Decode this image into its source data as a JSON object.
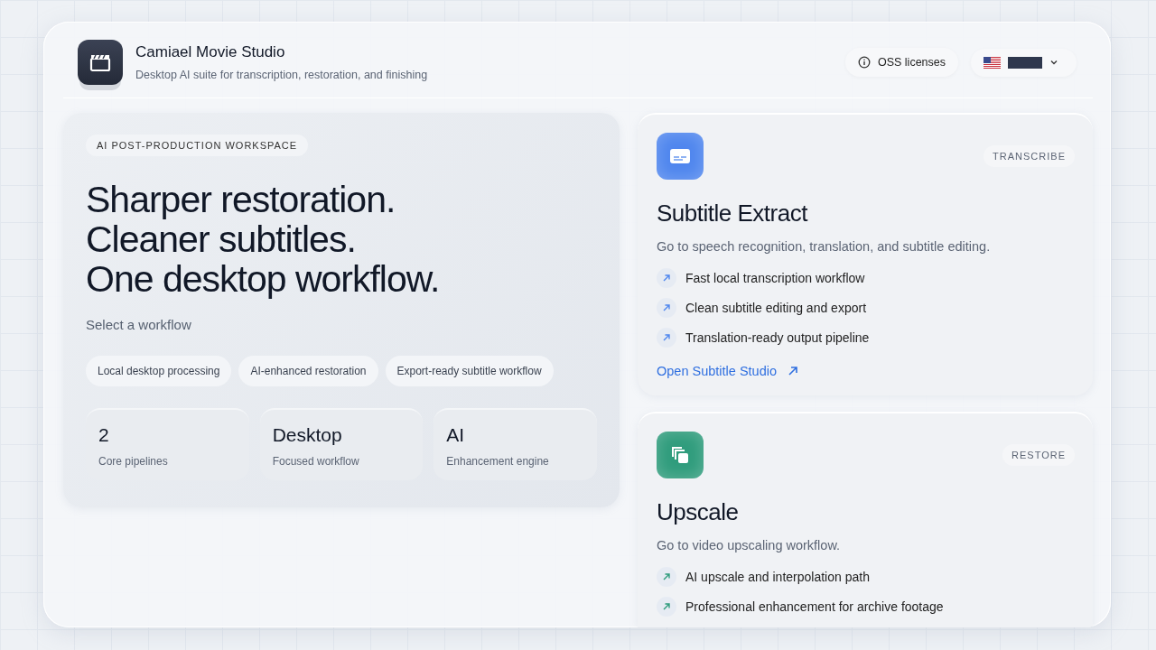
{
  "app": {
    "title": "Camiael Movie Studio",
    "subtitle": "Desktop AI suite for transcription, restoration, and finishing"
  },
  "header_actions": {
    "licenses": "OSS licenses"
  },
  "hero": {
    "eyebrow": "AI POST-PRODUCTION WORKSPACE",
    "headline": [
      "Sharper restoration.",
      "Cleaner subtitles.",
      "One desktop workflow."
    ],
    "prompt": "Select a workflow",
    "chips": [
      "Local desktop processing",
      "AI-enhanced restoration",
      "Export-ready subtitle workflow"
    ],
    "stats": [
      {
        "value": "2",
        "label": "Core pipelines"
      },
      {
        "value": "Desktop",
        "label": "Focused workflow"
      },
      {
        "value": "AI",
        "label": "Enhancement engine"
      }
    ]
  },
  "workflows": [
    {
      "kind": "subtitle",
      "color": "#4f86ee",
      "tag": "TRANSCRIBE",
      "title": "Subtitle Extract",
      "description": "Go to speech recognition, translation, and subtitle editing.",
      "features": [
        "Fast local transcription workflow",
        "Clean subtitle editing and export",
        "Translation-ready output pipeline"
      ],
      "link": "Open Subtitle Studio"
    },
    {
      "kind": "upscale",
      "color": "#2f9c7c",
      "tag": "RESTORE",
      "title": "Upscale",
      "description": "Go to video upscaling workflow.",
      "features": [
        "AI upscale and interpolation path",
        "Professional enhancement for archive footage"
      ]
    }
  ]
}
